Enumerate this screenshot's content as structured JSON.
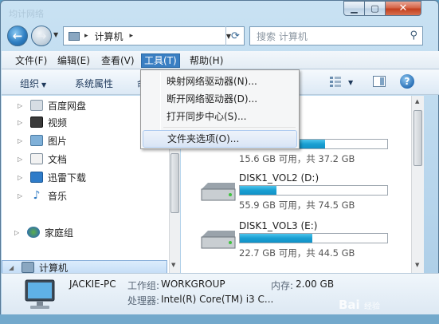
{
  "window": {
    "ghost_title": "均计网络"
  },
  "address": {
    "crumb": "计算机",
    "separator": "▸"
  },
  "search": {
    "placeholder": "搜索 计算机"
  },
  "menubar": [
    "文件(F)",
    "编辑(E)",
    "查看(V)",
    "工具(T)",
    "帮助(H)"
  ],
  "toolbar": {
    "organize": "组织",
    "system_properties": "系统属性",
    "partial": "命"
  },
  "nav": {
    "items": [
      "百度网盘",
      "视频",
      "图片",
      "文档",
      "迅雷下载",
      "音乐"
    ],
    "homegroup": "家庭组",
    "computer": "计算机"
  },
  "drives": [
    {
      "name": "",
      "free_text": "15.6 GB 可用，共 37.2 GB",
      "used_fraction": 0.58
    },
    {
      "name": "DISK1_VOL2 (D:)",
      "free_text": "55.9 GB 可用，共 74.5 GB",
      "used_fraction": 0.25
    },
    {
      "name": "DISK1_VOL3 (E:)",
      "free_text": "22.7 GB 可用，共 44.5 GB",
      "used_fraction": 0.49
    }
  ],
  "details": {
    "pc_name": "JACKIE-PC",
    "workgroup_label": "工作组:",
    "workgroup_value": "WORKGROUP",
    "memory_label": "内存:",
    "memory_value": "2.00 GB",
    "processor_label": "处理器:",
    "processor_value": "Intel(R) Core(TM) i3 C..."
  },
  "tools_menu": {
    "items": [
      "映射网络驱动器(N)...",
      "断开网络驱动器(D)...",
      "打开同步中心(S)...",
      "文件夹选项(O)..."
    ]
  },
  "watermark": {
    "text": "Bai",
    "suffix": "经验"
  },
  "colors": {
    "accent": "#3a7fc3",
    "drive_fill": "#1a9fd2",
    "close": "#c3401f"
  }
}
